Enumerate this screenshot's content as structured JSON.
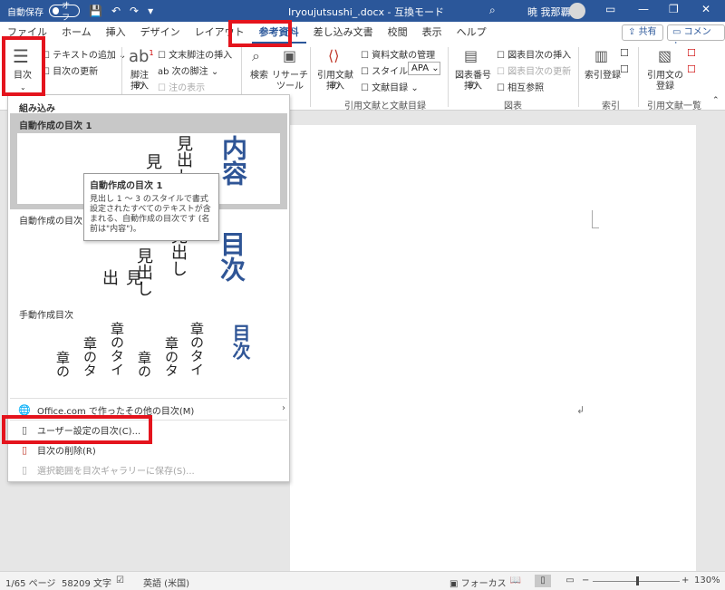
{
  "titlebar": {
    "autosave_label": "自動保存",
    "autosave_state": "オフ",
    "doc_title": "Iryoujutsushi_.docx - 互換モード",
    "user_name": "暁 我那覇"
  },
  "tabs": [
    "ファイル",
    "ホーム",
    "挿入",
    "デザイン",
    "レイアウト",
    "参考資料",
    "差し込み文書",
    "校閲",
    "表示",
    "ヘルプ"
  ],
  "active_tab": "参考資料",
  "share_label": "共有",
  "comment_label": "コメント",
  "ribbon": {
    "toc_button": "目次",
    "add_text": "テキストの追加",
    "update_toc": "目次の更新",
    "footnote_insert_1": "脚注の",
    "footnote_insert_2": "挿入",
    "endnote_insert": "文末脚注の挿入",
    "next_footnote": "次の脚注",
    "show_notes": "注の表示",
    "search": "検索",
    "researcher_1": "リサーチ",
    "researcher_2": "ツール",
    "insert_citation_1": "引用文献の",
    "insert_citation_2": "挿入",
    "manage_sources": "資料文献の管理",
    "style_label": "スタイル:",
    "style_value": "APA",
    "bibliography": "文献目録",
    "citations_group": "引用文献と文献目録",
    "insert_caption_1": "図表番号の",
    "insert_caption_2": "挿入",
    "insert_table_of_figures": "図表目次の挿入",
    "update_table": "図表目次の更新",
    "cross_reference": "相互参照",
    "captions_group": "図表",
    "mark_entry": "索引登録",
    "index_group": "索引",
    "mark_citation_1": "引用文の",
    "mark_citation_2": "登録",
    "table_of_authorities_group": "引用文献一覧"
  },
  "panel": {
    "builtin_header": "組み込み",
    "auto1_title": "自動作成の目次 1",
    "auto2_title": "自動作成の目次 2",
    "manual_title": "手動作成目次",
    "preview1": {
      "heading_big": "内容",
      "heading_1": "見出し",
      "heading_2": "見"
    },
    "preview2": {
      "heading_big": "目次",
      "heading_1": "見出し",
      "heading_2": "見出し",
      "heading_3": "見出"
    },
    "preview3": {
      "heading_big": "目次",
      "col_a": "章のタイ",
      "col_b": "章のタ",
      "col_c": "章の"
    },
    "office_more": "Office.com で作ったその他の目次(M)",
    "custom_toc": "ユーザー設定の目次(C)...",
    "remove_toc": "目次の削除(R)",
    "save_selection": "選択範囲を目次ギャラリーに保存(S)..."
  },
  "tooltip": {
    "title": "自動作成の目次 1",
    "body": "見出し 1 ～ 3 のスタイルで書式設定されたすべてのテキストが含まれる、自動作成の目次です (名前は\"内容\")。"
  },
  "statusbar": {
    "page": "1/65 ページ",
    "words": "58209 文字",
    "language": "英語 (米国)",
    "focus": "フォーカス",
    "zoom": "130%"
  }
}
